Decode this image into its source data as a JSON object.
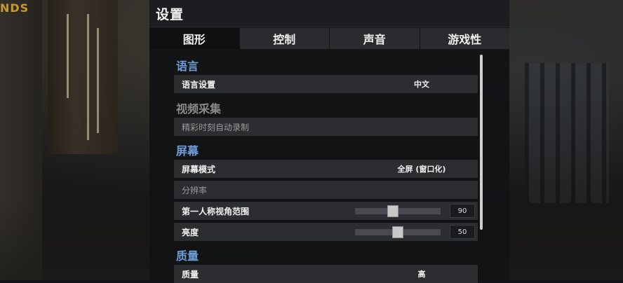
{
  "background": {
    "logo_fragment": "NDS"
  },
  "panel": {
    "title": "设置"
  },
  "tabs": [
    {
      "label": "图形",
      "active": true
    },
    {
      "label": "控制",
      "active": false
    },
    {
      "label": "声音",
      "active": false
    },
    {
      "label": "游戏性",
      "active": false
    }
  ],
  "sections": {
    "language": {
      "header": "语言",
      "rows": {
        "language_setting": {
          "label": "语言设置",
          "value": "中文"
        }
      }
    },
    "video_capture": {
      "header": "视频采集",
      "rows": {
        "highlight_record": {
          "label": "精彩时刻自动录制"
        }
      }
    },
    "screen": {
      "header": "屏幕",
      "rows": {
        "screen_mode": {
          "label": "屏幕模式",
          "value": "全屏 (窗口化)"
        },
        "resolution": {
          "label": "分辨率"
        },
        "fov": {
          "label": "第一人称视角范围",
          "value": "90",
          "slider_fraction": 0.43
        },
        "brightness": {
          "label": "亮度",
          "value": "50",
          "slider_fraction": 0.5
        }
      }
    },
    "quality": {
      "header": "质量",
      "rows": {
        "quality": {
          "label": "质量",
          "value": "高"
        }
      }
    }
  },
  "colors": {
    "accent": "#6d9ed8",
    "panel_bg": "#121315",
    "row_bg": "#2c2d31"
  }
}
